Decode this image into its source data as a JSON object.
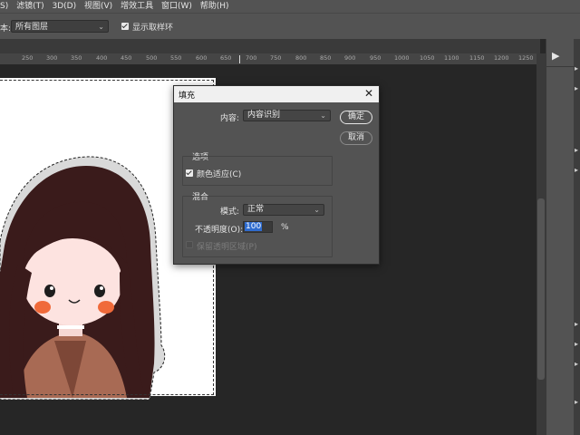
{
  "menubar": {
    "items": [
      "S)",
      "滤镜(T)",
      "3D(D)",
      "视图(V)",
      "增效工具",
      "窗口(W)",
      "帮助(H)"
    ]
  },
  "options_bar": {
    "sample_label": "本:",
    "sample_value": "所有图层",
    "show_ring_checked": true,
    "show_ring_label": "显示取样环"
  },
  "ruler": {
    "ticks": [
      "250",
      "300",
      "350",
      "400",
      "450",
      "500",
      "550",
      "600",
      "650",
      "700",
      "750",
      "800",
      "850",
      "900",
      "950",
      "1000",
      "1050",
      "1100",
      "1150",
      "1200",
      "1250"
    ]
  },
  "right_panel": {
    "play_icon": "play-icon"
  },
  "dialog": {
    "title": "填充",
    "content_label": "内容:",
    "content_value": "内容识别",
    "ok_label": "确定",
    "cancel_label": "取消",
    "options_group_label": "选项",
    "color_adapt_label": "颜色适应(C)",
    "color_adapt_checked": true,
    "blend_group_label": "混合",
    "mode_label": "模式:",
    "mode_value": "正常",
    "opacity_label": "不透明度(O):",
    "opacity_value": "100",
    "opacity_unit": "%",
    "preserve_label": "保留透明区域(P)",
    "preserve_checked": false,
    "preserve_enabled": false
  }
}
